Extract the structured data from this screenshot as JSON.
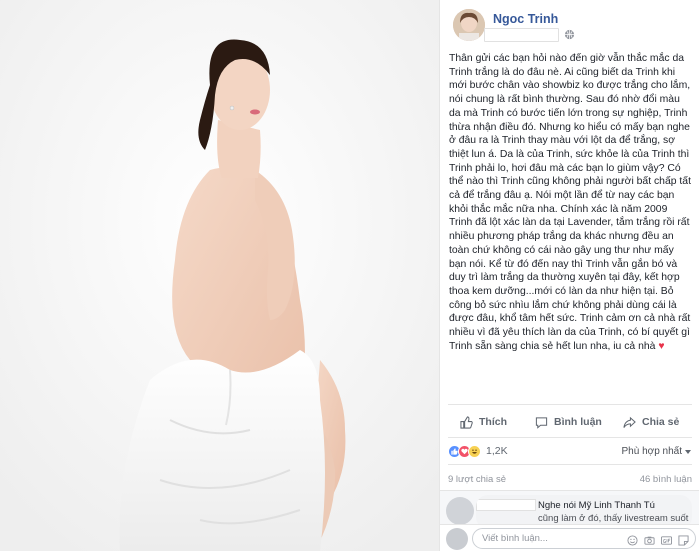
{
  "post": {
    "author": "Ngoc Trinh",
    "text_lines": [
      "Thân gửi các bạn hỏi nào đến giờ vẫn thắc mắc da",
      "Trinh trắng là do đâu nè. Ai cũng biết da Trinh khi",
      "mới bước chân vào showbiz ko được trắng cho lắm,",
      "nói chung là rất bình thường. Sau đó nhờ đổi màu",
      "da mà Trinh có bước tiến lớn trong sự nghiệp, Trinh",
      "thừa nhận điều đó. Nhưng ko hiểu có mấy bạn nghe",
      "ở đâu ra là Trinh thay màu với lột da để trắng, sợ",
      "thiệt lun á. Da là của Trinh, sức khỏe là của Trinh thì",
      "Trinh phải lo, hơi đâu mà các bạn lo giùm vậy? Có",
      "thể nào thì Trinh cũng không phải người bất chấp tất",
      "cả để trắng đâu ạ. Nói một lần để từ nay các bạn",
      "khỏi thắc mắc nữa nha. Chính xác là năm 2009",
      "Trinh đã lột xác làn da tại Lavender, tắm trắng rồi rất",
      "nhiều phương pháp trắng da khác nhưng đều an",
      "toàn chứ không có cái nào gây ung thư như mấy",
      "bạn nói. Kể từ đó đến nay thì Trinh vẫn gắn bó và",
      "duy trì làm trắng da thường xuyên tại đây, kết hợp",
      "thoa kem dưỡng...mới có làn da như hiện tại. Bỏ",
      "công bỏ sức nhìu lắm chứ không phải dùng cái là",
      "được đâu, khổ tâm hết sức. Trinh cảm ơn cả nhà rất",
      "nhiều vì đã yêu thích làn da của Trinh, có bí quyết gì",
      "Trinh sẵn sàng chia sẻ hết lun nha, iu cả nhà"
    ],
    "heart": "♥"
  },
  "actions": {
    "like": "Thích",
    "comment": "Bình luận",
    "share": "Chia sẻ"
  },
  "reactions": {
    "count": "1,2K",
    "sort_label": "Phù hợp nhất"
  },
  "stats": {
    "shares": "9 lượt chia sẻ",
    "comments": "46 bình luận"
  },
  "comment": {
    "line1": "Nghe nói Mỹ Linh Thanh Tú",
    "line2": "cũng làm ở đó, thấy livestream suốt"
  },
  "composer": {
    "placeholder": "Viết bình luận..."
  },
  "colors": {
    "link": "#365899",
    "like_blue": "#5890ff",
    "love_red": "#f25268"
  }
}
